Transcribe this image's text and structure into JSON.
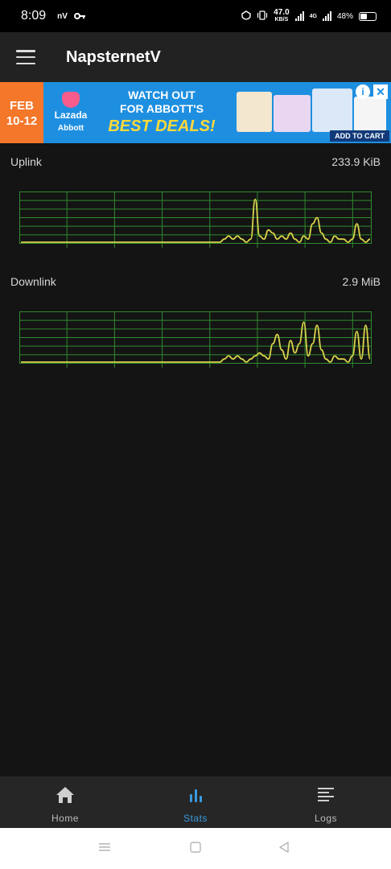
{
  "status_bar": {
    "time": "8:09",
    "carrier_badge": "nV",
    "speed_value": "47.0",
    "speed_unit": "KB/S",
    "network": "4G",
    "battery": "48%",
    "icons": [
      "key-icon",
      "vpn-icon",
      "vibrate-icon",
      "signal-icon",
      "battery-icon"
    ]
  },
  "app_bar": {
    "title": "NapsternetV",
    "menu_icon": "menu-icon"
  },
  "ad": {
    "date_line1": "FEB",
    "date_line2": "10-12",
    "brand1": "Lazada",
    "brand2": "Abbott",
    "headline1": "WATCH OUT",
    "headline2": "FOR ABBOTT'S",
    "headline3": "BEST DEALS!",
    "cta": "ADD TO CART",
    "colors": {
      "background": "#1e8fe0",
      "date_bg": "#f4772a",
      "accent": "#ffd93a"
    }
  },
  "stats": {
    "uplink": {
      "label": "Uplink",
      "value": "233.9 KiB"
    },
    "downlink": {
      "label": "Downlink",
      "value": "2.9 MiB"
    }
  },
  "chart_data": [
    {
      "type": "line",
      "x": [
        0,
        1,
        2,
        3,
        4,
        5,
        6,
        7,
        8,
        9,
        10,
        11,
        12,
        13,
        14,
        15,
        16,
        17,
        18,
        19,
        20,
        21,
        22,
        23,
        24,
        25,
        26,
        27,
        28,
        29,
        30,
        31,
        32,
        33,
        34,
        35,
        36,
        37,
        38,
        39,
        40,
        41,
        42,
        43,
        44,
        45,
        46,
        47,
        48,
        49,
        50,
        51,
        52,
        53,
        54,
        55,
        56,
        57,
        58,
        59,
        60,
        61,
        62,
        63,
        64,
        65,
        66,
        67,
        68,
        69,
        70,
        71,
        72,
        73,
        74,
        75,
        76,
        77,
        78,
        79
      ],
      "series": [
        {
          "values": [
            0,
            0,
            0,
            0,
            0,
            0,
            0,
            0,
            0,
            0,
            0,
            0,
            0,
            0,
            0,
            0,
            0,
            0,
            0,
            0,
            0,
            0,
            0,
            0,
            0,
            0,
            0,
            0,
            0,
            0,
            0,
            0,
            0,
            0,
            0,
            0,
            0,
            0,
            0,
            0,
            0,
            0,
            0,
            0,
            0,
            0,
            1,
            2,
            1,
            2,
            1,
            0,
            1,
            14,
            2,
            1,
            4,
            3,
            1,
            2,
            1,
            3,
            1,
            0,
            2,
            1,
            6,
            8,
            3,
            1,
            0,
            2,
            1,
            1,
            0,
            1,
            6,
            1,
            0,
            1
          ]
        }
      ],
      "ylim": [
        0,
        16
      ],
      "grid": true,
      "colors": {
        "line": "#d8d24a",
        "grid": "#2f8a2f"
      }
    },
    {
      "type": "line",
      "x": [
        0,
        1,
        2,
        3,
        4,
        5,
        6,
        7,
        8,
        9,
        10,
        11,
        12,
        13,
        14,
        15,
        16,
        17,
        18,
        19,
        20,
        21,
        22,
        23,
        24,
        25,
        26,
        27,
        28,
        29,
        30,
        31,
        32,
        33,
        34,
        35,
        36,
        37,
        38,
        39,
        40,
        41,
        42,
        43,
        44,
        45,
        46,
        47,
        48,
        49,
        50,
        51,
        52,
        53,
        54,
        55,
        56,
        57,
        58,
        59,
        60,
        61,
        62,
        63,
        64,
        65,
        66,
        67,
        68,
        69,
        70,
        71,
        72,
        73,
        74,
        75,
        76,
        77,
        78,
        79
      ],
      "series": [
        {
          "values": [
            0,
            0,
            0,
            0,
            0,
            0,
            0,
            0,
            0,
            0,
            0,
            0,
            0,
            0,
            0,
            0,
            0,
            0,
            0,
            0,
            0,
            0,
            0,
            0,
            0,
            0,
            0,
            0,
            0,
            0,
            0,
            0,
            0,
            0,
            0,
            0,
            0,
            0,
            0,
            0,
            0,
            0,
            0,
            0,
            0,
            0,
            1,
            2,
            1,
            2,
            1,
            0,
            1,
            2,
            3,
            2,
            1,
            6,
            9,
            4,
            1,
            7,
            3,
            6,
            13,
            2,
            6,
            12,
            4,
            1,
            0,
            2,
            1,
            1,
            0,
            2,
            10,
            1,
            12,
            1
          ]
        }
      ],
      "ylim": [
        0,
        16
      ],
      "grid": true,
      "colors": {
        "line": "#d8d24a",
        "grid": "#2f8a2f"
      }
    }
  ],
  "bottom_nav": {
    "items": [
      {
        "label": "Home",
        "icon": "home-icon",
        "active": false
      },
      {
        "label": "Stats",
        "icon": "stats-icon",
        "active": true
      },
      {
        "label": "Logs",
        "icon": "logs-icon",
        "active": false
      }
    ],
    "active_color": "#3a9ae0"
  },
  "system_nav": {
    "icons": [
      "recent-apps-icon",
      "home-button-icon",
      "back-icon"
    ]
  }
}
